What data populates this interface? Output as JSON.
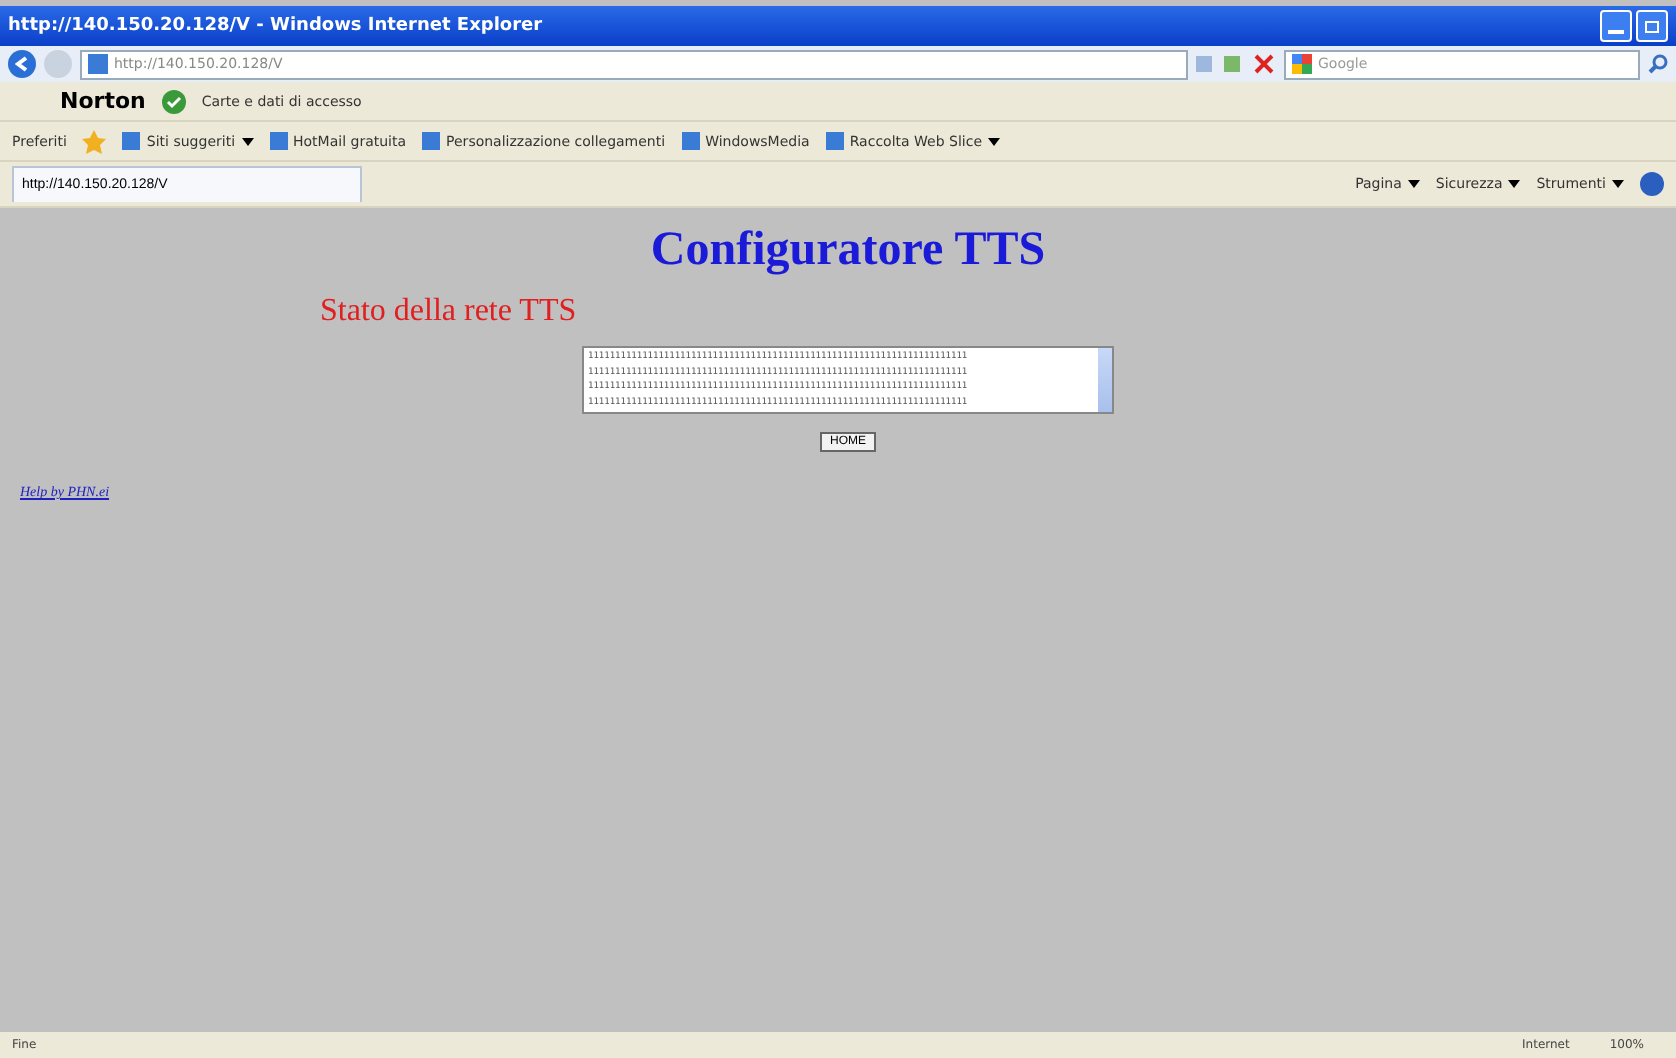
{
  "window": {
    "title": "http://140.150.20.128/V - Windows Internet Explorer"
  },
  "address_bar": {
    "value": "http://140.150.20.128/V"
  },
  "search": {
    "placeholder": "Google"
  },
  "norton_bar": {
    "brand": "Norton",
    "items": [
      "Carte e dati di accesso"
    ]
  },
  "favorites_bar": {
    "favorites": "Preferiti",
    "links": [
      {
        "label": "Siti suggeriti",
        "dropdown": true
      },
      {
        "label": "HotMail gratuita",
        "dropdown": false
      },
      {
        "label": "Personalizzazione collegamenti",
        "dropdown": false
      },
      {
        "label": "WindowsMedia",
        "dropdown": false
      },
      {
        "label": "Raccolta Web Slice",
        "dropdown": true
      }
    ]
  },
  "tabs": [
    {
      "label": "http://140.150.20.128/V",
      "selected": true
    }
  ],
  "command_bar": [
    "Pagina",
    "Sicurezza",
    "Strumenti"
  ],
  "page": {
    "heading": "Configuratore TTS",
    "subheading": "Stato della rete TTS",
    "textarea_lines": [
      "1111111111111111111111111111111111111111111111111111111111111111111111",
      "1111111111111111111111111111111111111111111111111111111111111111111111",
      "1111111111111111111111111111111111111111111111111111111111111111111111",
      "1111111111111111111111111111111111111111111111111111111111111111111111"
    ],
    "button": "HOME",
    "link": "Help by PHN.ei"
  },
  "status_bar": {
    "text": "Fine",
    "zone": "Internet",
    "zoom": "100%"
  }
}
